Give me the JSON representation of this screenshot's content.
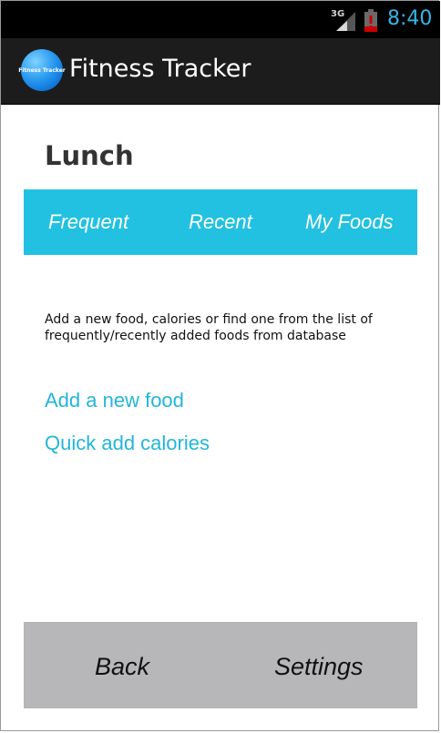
{
  "status_bar": {
    "network": "3G",
    "time": "8:40",
    "colors": {
      "time": "#33b5e5",
      "battery_alert": "#cc0000"
    }
  },
  "action_bar": {
    "icon_text": "Fitness Tracker",
    "title": "Fitness Tracker"
  },
  "meal": {
    "title": "Lunch"
  },
  "tabs": [
    {
      "label": "Frequent"
    },
    {
      "label": "Recent"
    },
    {
      "label": "My Foods"
    }
  ],
  "hint": "Add a new food, calories or find one from the list of frequently/recently added foods from database",
  "actions": {
    "add_food": "Add a new food",
    "quick_add": "Quick add calories"
  },
  "bottom": {
    "back": "Back",
    "settings": "Settings"
  },
  "colors": {
    "accent": "#22c1e1",
    "link": "#22b6d9",
    "bottom_bar": "#b7b6b8"
  }
}
